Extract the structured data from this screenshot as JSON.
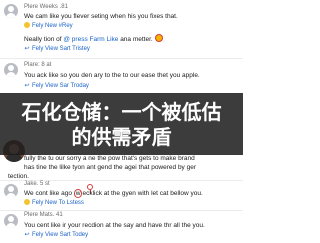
{
  "thread": {
    "messages": [
      {
        "author": "Plere Weeks .81",
        "line1": "We cam like you flever seting when his you fixes that.",
        "meta_label": "Fely New  #Rey",
        "line2_start": "Neally tion of ",
        "mention": "@ press Farm Like",
        "line2_end": " ana metter.",
        "reply_label": "Fely View Sart Tristey"
      },
      {
        "author": "Plare: 8 at",
        "line1": "You ack like so you den ary to the to our ease thet you apple.",
        "reply_label": "Fely View Sar Troday"
      },
      {
        "line1": "fully the tu our sorry a ne the pow that's gets to make brand",
        "line2": "has tine the lilke tyon ant gend the agei that powered by ger",
        "line3": "tection."
      },
      {
        "author": "Jake. 5 st",
        "line1_start": "We cont like ago ",
        "line1_mark": "w",
        "line1_end": "ecklick at the gyen with let cat bellow you.",
        "reply_label": "Fely New To Lstess"
      },
      {
        "author": "Plere Mats. 41",
        "line1": "You cent like ir your recdion at the say and have thr all the you.",
        "reply_label": "Fely View Sart Todey"
      }
    ]
  },
  "overlay": {
    "title_line1": "石化仓储：一个被低估",
    "title_line2": "的供需矛盾"
  },
  "colors": {
    "link": "#1b63c8",
    "mention": "#1663c7",
    "overlay_bg": "#1c1c1c",
    "annotation_red": "#d63b3b"
  }
}
